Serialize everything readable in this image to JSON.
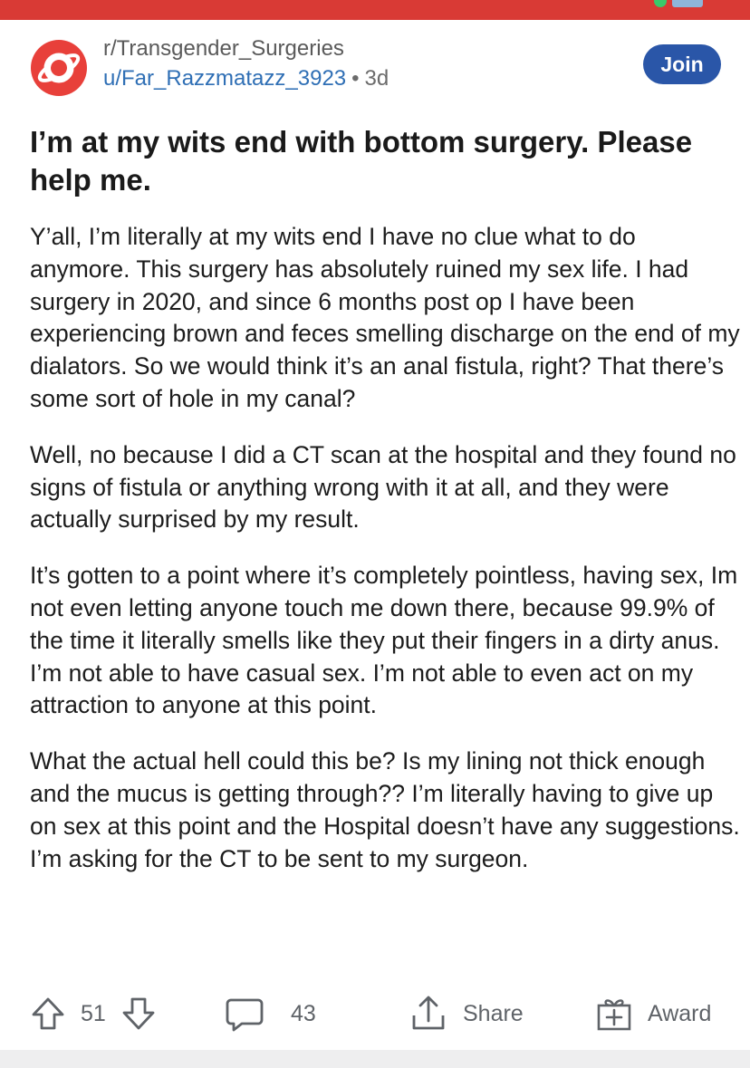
{
  "post": {
    "subreddit": "r/Transgender_Surgeries",
    "author": "u/Far_Razzmatazz_3923",
    "separator": "•",
    "age": "3d",
    "join_label": "Join",
    "title": "I’m at my wits end with bottom surgery. Please help me.",
    "paragraphs": [
      "Y’all, I’m literally at my wits end I have no clue what to do anymore. This surgery has absolutely ruined my sex life.  I had surgery in 2020, and since 6 months post op I have been experiencing brown and feces smelling discharge on the end of my dialators. So we would think it’s an anal fistula, right? That there’s some sort of hole in my canal?",
      "Well, no because I did a CT scan at the hospital and they found no signs of fistula or anything wrong with it at all, and they were actually surprised by my result.",
      "It’s gotten to a point where it’s completely pointless, having sex, Im not even letting anyone touch me down there, because 99.9% of the time it literally smells like they put their fingers in a dirty anus. I’m not able to have casual sex. I’m not able to even act on my attraction to anyone at this point.",
      "What the actual hell could this be?  Is my lining not thick enough and the mucus is getting through?? I’m literally having to give up on sex at this point and the Hospital doesn’t have any suggestions. I’m asking for the CT to be sent to my surgeon."
    ]
  },
  "actions": {
    "votes": "51",
    "comments": "43",
    "share_label": "Share",
    "award_label": "Award"
  },
  "icons": {
    "subreddit_avatar": "planet-icon",
    "upvote": "arrow-up-icon",
    "downvote": "arrow-down-icon",
    "comments": "comment-bubble-icon",
    "share": "share-icon",
    "award": "gift-icon"
  },
  "colors": {
    "topbar": "#d93a35",
    "avatar": "#e8403a",
    "username": "#2f6fb5",
    "join_button": "#2a56a8"
  }
}
